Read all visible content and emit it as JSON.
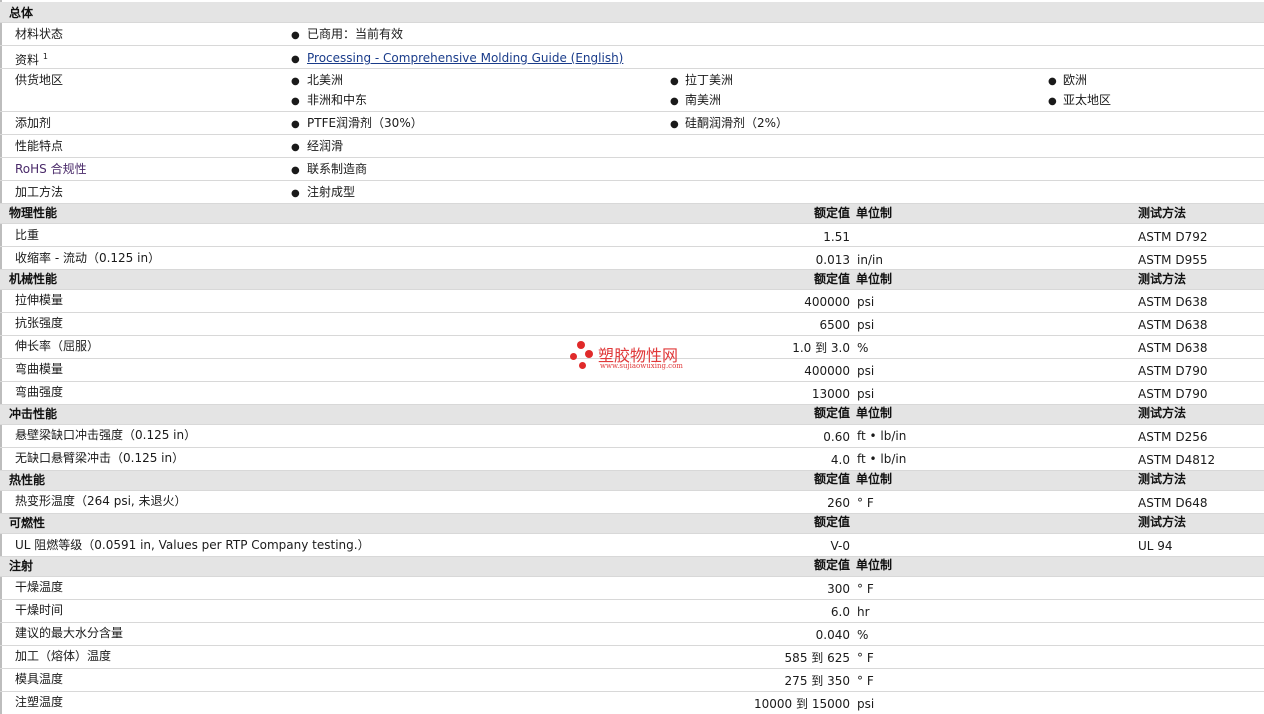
{
  "general": {
    "title": "总体",
    "rows": {
      "status": {
        "label": "材料状态",
        "v1": "已商用：当前有效"
      },
      "docs": {
        "label": "资料",
        "sup": "1",
        "link": "Processing - Comprehensive Molding Guide (English)"
      },
      "regions": {
        "label": "供货地区",
        "r1": "北美洲",
        "r2": "拉丁美洲",
        "r3": "欧洲",
        "r4": "非洲和中东",
        "r5": "南美洲",
        "r6": "亚太地区"
      },
      "additives": {
        "label": "添加剂",
        "v1": "PTFE润滑剂（30%）",
        "v2": "硅酮润滑剂（2%）"
      },
      "features": {
        "label": "性能特点",
        "v1": "经润滑"
      },
      "rohs": {
        "label": "RoHS 合规性",
        "v1": "联系制造商"
      },
      "process": {
        "label": "加工方法",
        "v1": "注射成型"
      }
    }
  },
  "physical": {
    "title": "物理性能",
    "h_value": "额定值",
    "h_unit": "单位制",
    "h_test": "测试方法",
    "rows": [
      {
        "label": "比重",
        "value": "1.51",
        "unit": "",
        "test": "ASTM D792"
      },
      {
        "label": "收缩率 - 流动（0.125 in）",
        "value": "0.013",
        "unit": "in/in",
        "test": "ASTM D955"
      }
    ]
  },
  "mechanical": {
    "title": "机械性能",
    "h_value": "额定值",
    "h_unit": "单位制",
    "h_test": "测试方法",
    "rows": [
      {
        "label": "拉伸模量",
        "value": "400000",
        "unit": "psi",
        "test": "ASTM D638"
      },
      {
        "label": "抗张强度",
        "value": "6500",
        "unit": "psi",
        "test": "ASTM D638"
      },
      {
        "label": "伸长率（屈服）",
        "value": "1.0 到  3.0",
        "unit": "%",
        "test": "ASTM D638"
      },
      {
        "label": "弯曲模量",
        "value": "400000",
        "unit": "psi",
        "test": "ASTM D790"
      },
      {
        "label": "弯曲强度",
        "value": "13000",
        "unit": "psi",
        "test": "ASTM D790"
      }
    ]
  },
  "impact": {
    "title": "冲击性能",
    "h_value": "额定值",
    "h_unit": "单位制",
    "h_test": "测试方法",
    "rows": [
      {
        "label": "悬壁梁缺口冲击强度（0.125 in）",
        "value": "0.60",
        "unit": "ft • lb/in",
        "test": "ASTM D256"
      },
      {
        "label": "无缺口悬臂梁冲击（0.125 in）",
        "value": "4.0",
        "unit": "ft • lb/in",
        "test": "ASTM D4812"
      }
    ]
  },
  "thermal": {
    "title": "热性能",
    "h_value": "额定值",
    "h_unit": "单位制",
    "h_test": "测试方法",
    "rows": [
      {
        "label": "热变形温度（264 psi, 未退火）",
        "value": "260",
        "unit": "° F",
        "test": "ASTM D648"
      }
    ]
  },
  "flammability": {
    "title": "可燃性",
    "h_value": "额定值",
    "h_test": "测试方法",
    "rows": [
      {
        "label": "UL 阻燃等级（0.0591 in, Values per RTP Company testing.）",
        "value": "V-0",
        "test": "UL 94"
      }
    ]
  },
  "injection": {
    "title": "注射",
    "h_value": "额定值",
    "h_unit": "单位制",
    "rows": [
      {
        "label": "干燥温度",
        "value": "300",
        "unit": "° F"
      },
      {
        "label": "干燥时间",
        "value": "6.0",
        "unit": "hr"
      },
      {
        "label": "建议的最大水分含量",
        "value": "0.040",
        "unit": "%"
      },
      {
        "label": "加工（熔体）温度",
        "value": "585 到  625",
        "unit": "° F"
      },
      {
        "label": "模具温度",
        "value": "275 到  350",
        "unit": "° F"
      },
      {
        "label": "注塑温度",
        "value": "10000 到  15000",
        "unit": "psi"
      }
    ]
  },
  "watermark": {
    "title": "塑胶物性网",
    "url": "www.sujiaowuxing.com",
    "color": "#e0393a"
  },
  "colors": {
    "header_bg": "#e4e4e4",
    "link": "#1a3c8a",
    "border": "#d8d8d8"
  }
}
